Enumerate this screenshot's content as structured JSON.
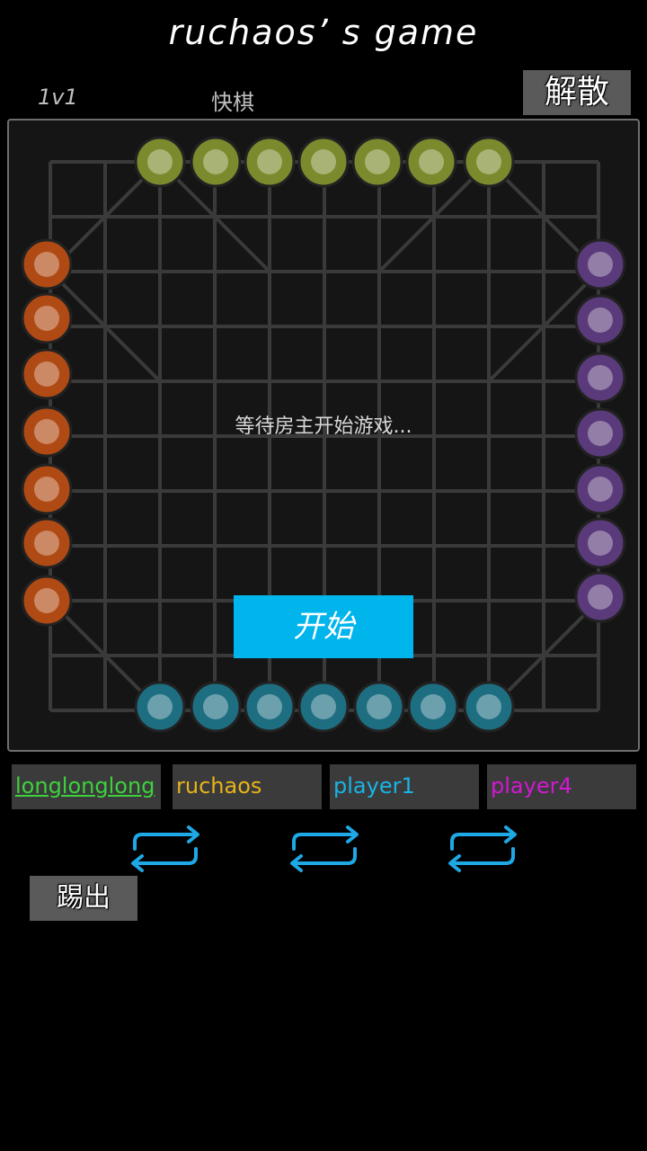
{
  "header": {
    "title": "ruchaos’ s game",
    "mode": "1v1",
    "speed": "快棋",
    "dissolve_label": "解散"
  },
  "board": {
    "status_text": "等待房主开始游戏...",
    "start_label": "开始"
  },
  "players": [
    {
      "name": "longlonglong",
      "color": "#3cd23c"
    },
    {
      "name": "ruchaos",
      "color": "#e6b418"
    },
    {
      "name": "player1",
      "color": "#18b4e6"
    },
    {
      "name": "player4",
      "color": "#d218d2"
    }
  ],
  "swap_icons": [
    "swap-icon",
    "swap-icon",
    "swap-icon"
  ],
  "kick_label": "踢出",
  "armies": {
    "top": {
      "color": "#7a8a2c"
    },
    "left": {
      "color": "#b04a14"
    },
    "right": {
      "color": "#5a3a7a"
    },
    "bottom": {
      "color": "#1e6e82"
    }
  }
}
